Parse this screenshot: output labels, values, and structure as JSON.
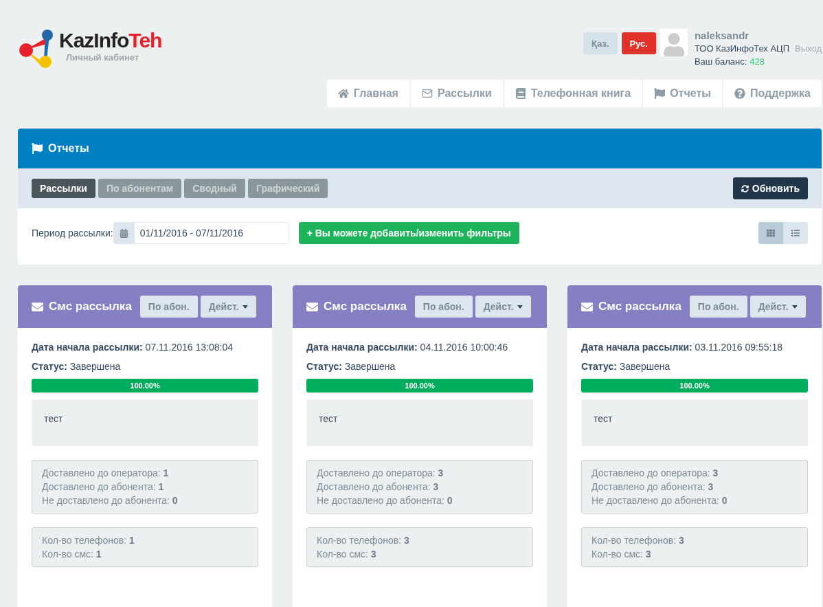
{
  "logo": {
    "name_dark": "KazInfo",
    "name_accent": "Teh",
    "subtitle": "Личный кабинет"
  },
  "languages": [
    {
      "label": "Қаз.",
      "selected": false
    },
    {
      "label": "Рус.",
      "selected": true
    }
  ],
  "user": {
    "login": "naleksandr",
    "company": "ТОО КазИнфоТех АЦП",
    "logout": "Выход",
    "balance_label": "Ваш баланс:",
    "balance": "428"
  },
  "nav": [
    {
      "kind": "home",
      "label": "Главная"
    },
    {
      "kind": "mail",
      "label": "Рассылки"
    },
    {
      "kind": "book",
      "label": "Телефонная книга"
    },
    {
      "kind": "flag",
      "label": "Отчеты"
    },
    {
      "kind": "help",
      "label": "Поддержка"
    }
  ],
  "panel": {
    "title": "Отчеты",
    "tabs": [
      {
        "label": "Рассылки",
        "selected": true
      },
      {
        "label": "По абонентам",
        "selected": false
      },
      {
        "label": "Сводный",
        "selected": false
      },
      {
        "label": "Графический",
        "selected": false
      }
    ],
    "refresh": "Обновить",
    "period_label": "Период рассылки:",
    "period_value": "01/11/2016 - 07/11/2016",
    "filters_button": "+ Вы можете добавить/изменить фильтры",
    "views": [
      {
        "kind": "grid",
        "selected": true
      },
      {
        "kind": "list",
        "selected": false
      }
    ]
  },
  "cards": [
    {
      "title": "Смс рассылка",
      "by_subscriber": "По абон.",
      "actions": "Дейст.",
      "start": "**Дата начала рассылки:** 07.11.2016 13:08:04",
      "status": "**Статус:** Завершена",
      "level": 1,
      "progress": "100.00%",
      "message": "тест",
      "delivery": [
        "Доставлено до оператора: **1**",
        "Доставлено до абонента: **1**",
        "Не доставлено до абонента: **0**"
      ],
      "counts": [
        "Кол-во телефонов: **1**",
        "Кол-во смс: **1**"
      ]
    },
    {
      "title": "Смс рассылка",
      "by_subscriber": "По абон.",
      "actions": "Дейст.",
      "start": "**Дата начала рассылки:** 04.11.2016 10:00:46",
      "status": "**Статус:** Завершена",
      "level": 1,
      "progress": "100.00%",
      "message": "тест",
      "delivery": [
        "Доставлено до оператора: **3**",
        "Доставлено до абонента: **3**",
        "Не доставлено до абонента: **0**"
      ],
      "counts": [
        "Кол-во телефонов: **3**",
        "Кол-во смс: **3**"
      ]
    },
    {
      "title": "Смс рассылка",
      "by_subscriber": "По абон.",
      "actions": "Дейст.",
      "start": "**Дата начала рассылки:** 03.11.2016 09:55:18",
      "status": "**Статус:** Завершена",
      "level": 1,
      "progress": "100.00%",
      "message": "тест",
      "delivery": [
        "Доставлено до оператора: **3**",
        "Доставлено до абонента: **3**",
        "Не доставлено до абонента: **0**"
      ],
      "counts": [
        "Кол-во телефонов: **3**",
        "Кол-во смс: **3**"
      ]
    }
  ]
}
